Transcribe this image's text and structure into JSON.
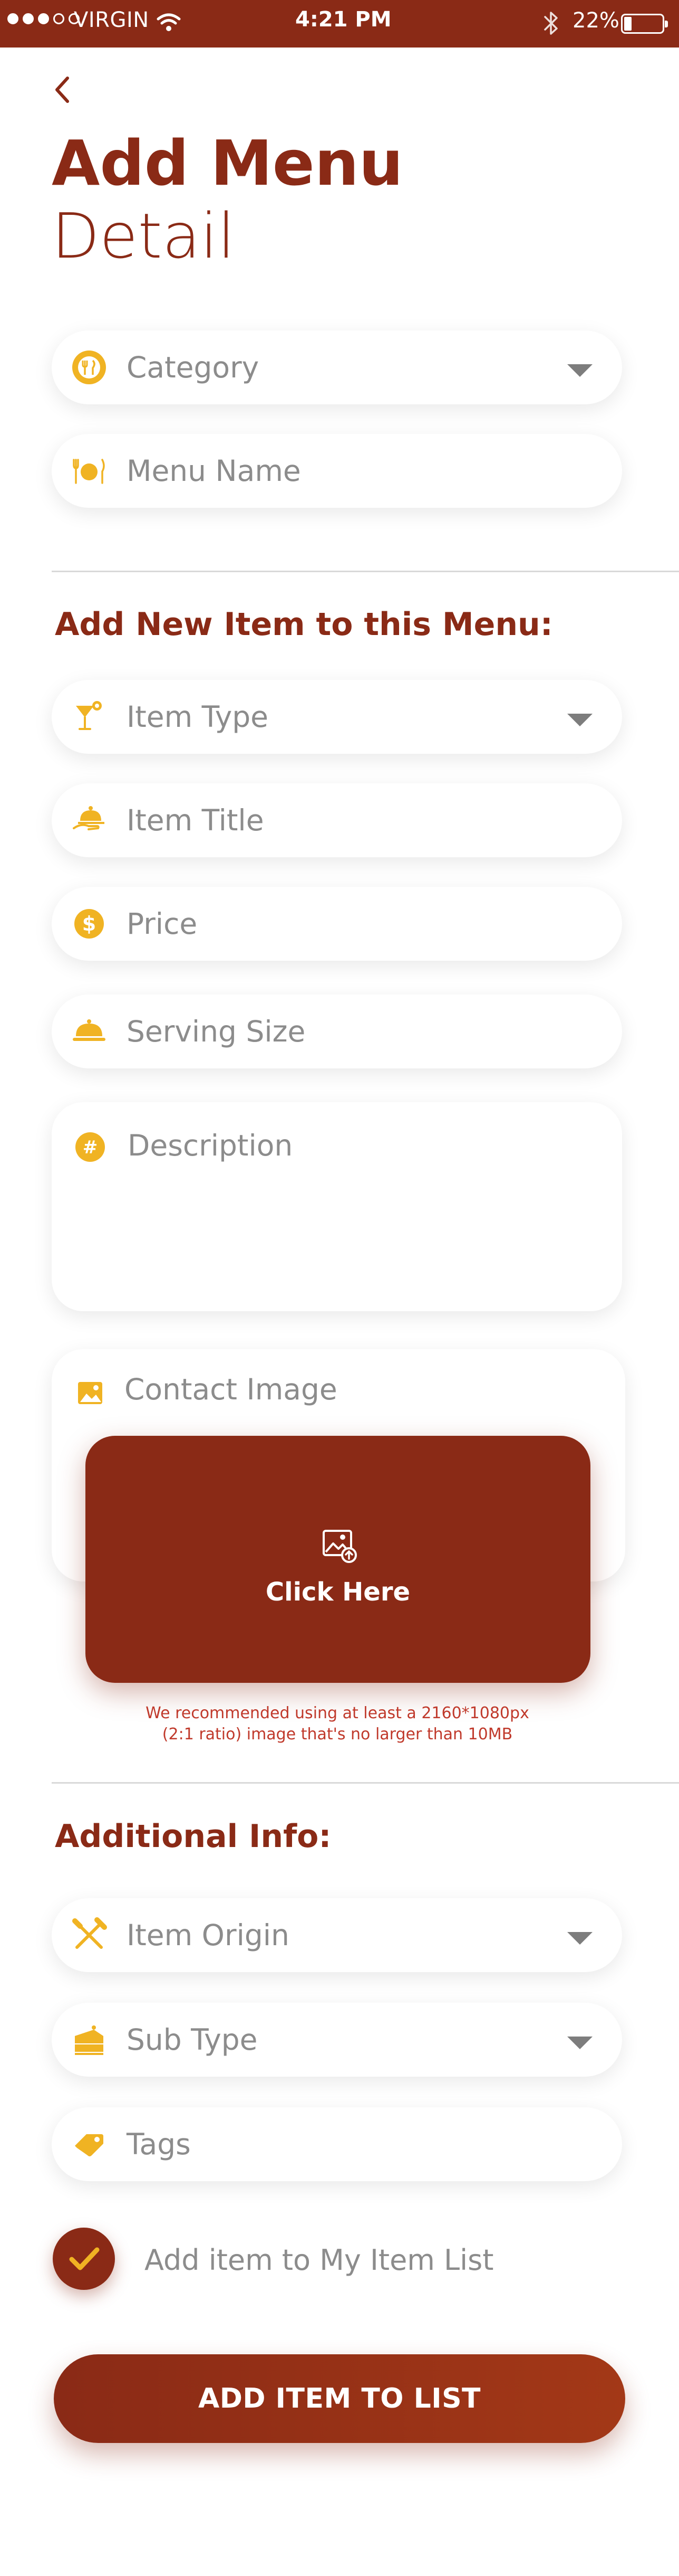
{
  "status_bar": {
    "carrier": "VIRGIN",
    "time": "4:21 PM",
    "battery": "22%",
    "signal_dots_filled": 3,
    "signal_dots_total": 5
  },
  "header": {
    "title": "Add Menu",
    "subtitle": "Detail"
  },
  "menu_fields": {
    "category": "Category",
    "menu_name": "Menu Name"
  },
  "new_item_section": {
    "heading": "Add New Item to this Menu:",
    "item_type": "Item Type",
    "item_title": "Item Title",
    "price": "Price",
    "serving_size": "Serving Size",
    "description": "Description",
    "contact_image": "Contact Image",
    "upload_label": "Click Here",
    "hint_line1": "We recommended using at least a 2160*1080px",
    "hint_line2": "(2:1 ratio) image that's no larger than 10MB"
  },
  "additional_section": {
    "heading": "Additional Info:",
    "item_origin": "Item Origin",
    "sub_type": "Sub Type",
    "tags": "Tags"
  },
  "my_list_checkbox": {
    "label": "Add item to My Item List",
    "checked": true
  },
  "cta_label": "ADD ITEM TO LIST",
  "colors": {
    "brand": "#8a2a16",
    "accent_icon": "#f0b323",
    "placeholder": "#8c8c8c",
    "hint": "#c0392b"
  },
  "icons": {
    "back": "chevron-left-icon",
    "category": "category-icon",
    "menu_name": "cutlery-icon",
    "item_type": "cocktail-icon",
    "item_title": "serving-hand-icon",
    "price": "dollar-icon",
    "serving_size": "cloche-icon",
    "description": "hashtag-icon",
    "contact_image": "image-icon",
    "upload": "image-upload-icon",
    "item_origin": "crossed-utensils-icon",
    "sub_type": "cake-icon",
    "tags": "tag-icon",
    "checkbox": "check-icon"
  }
}
